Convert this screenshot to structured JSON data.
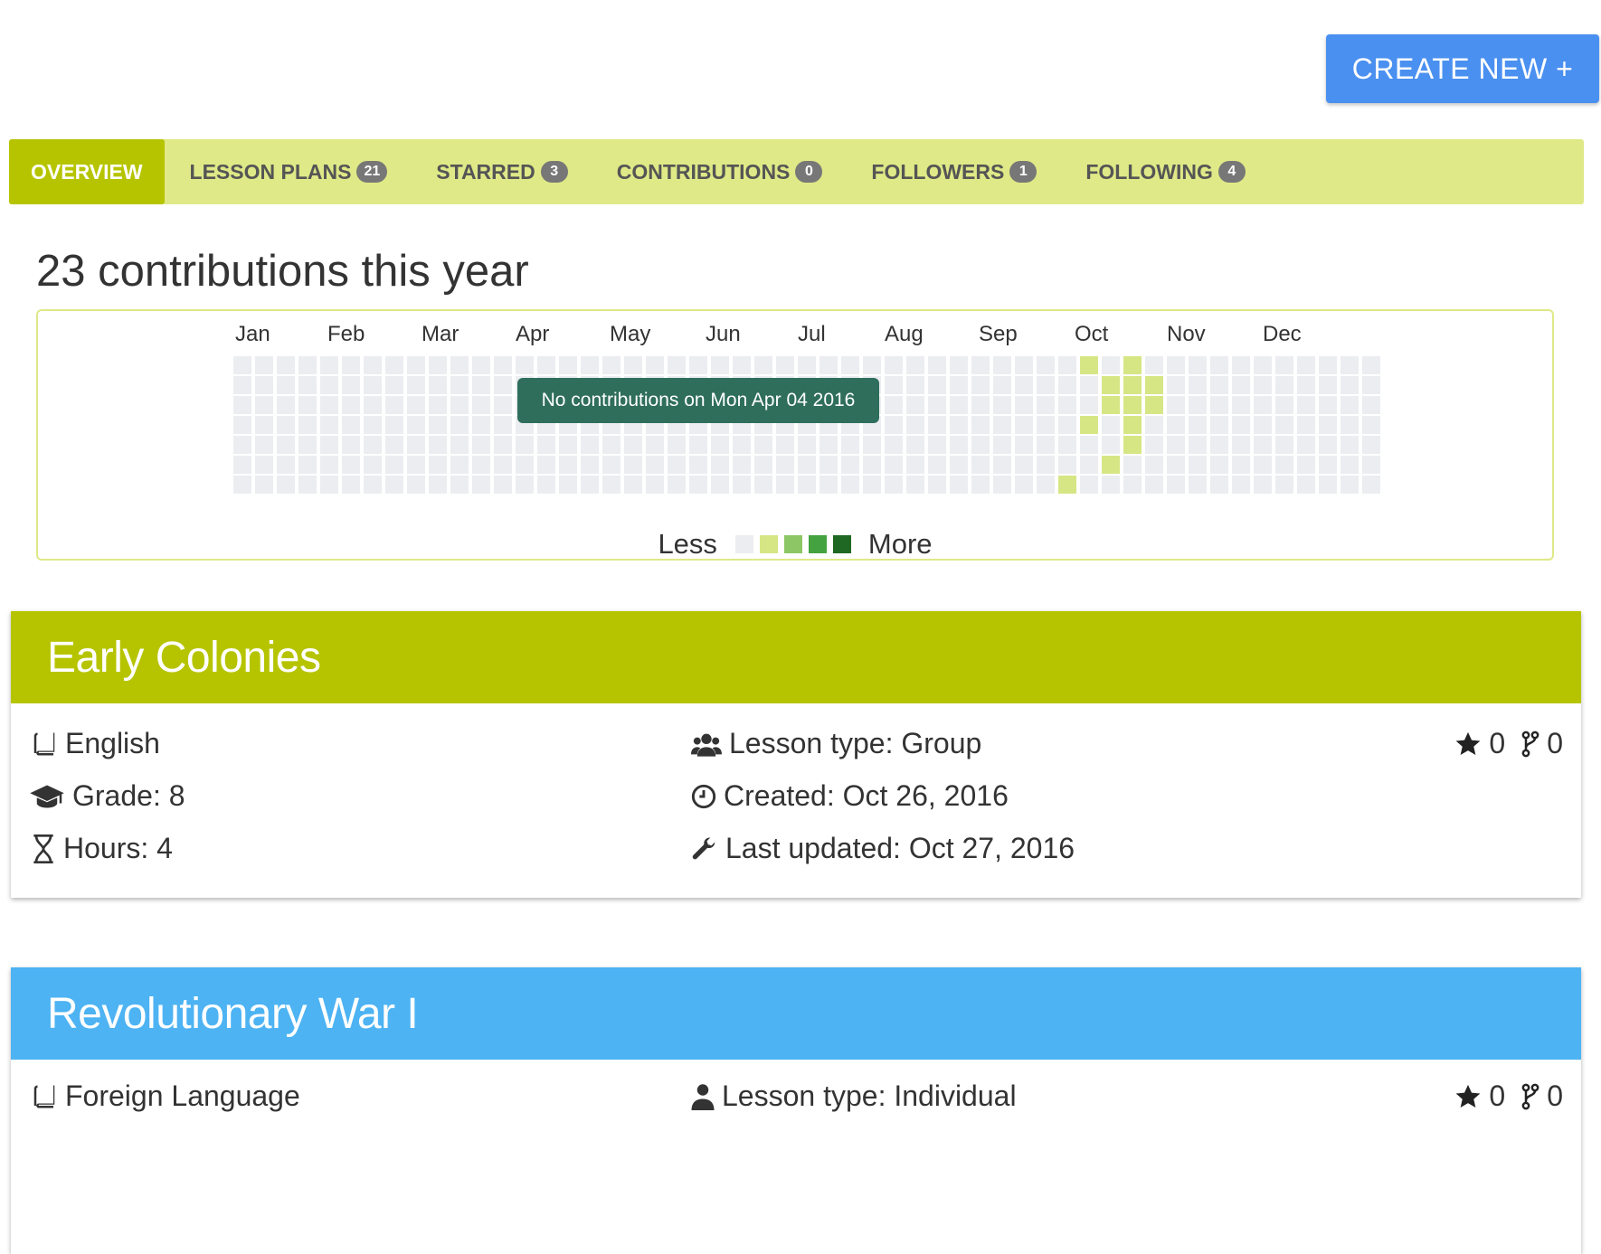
{
  "header": {
    "create_label": "CREATE NEW +"
  },
  "tabs": [
    {
      "label": "OVERVIEW",
      "count": null,
      "active": true
    },
    {
      "label": "LESSON PLANS",
      "count": "21"
    },
    {
      "label": "STARRED",
      "count": "3"
    },
    {
      "label": "CONTRIBUTIONS",
      "count": "0"
    },
    {
      "label": "FOLLOWERS",
      "count": "1"
    },
    {
      "label": "FOLLOWING",
      "count": "4"
    }
  ],
  "contributions": {
    "title": "23 contributions this year",
    "months": [
      "Jan",
      "Feb",
      "Mar",
      "Apr",
      "May",
      "Jun",
      "Jul",
      "Aug",
      "Sep",
      "Oct",
      "Nov",
      "Dec"
    ],
    "tooltip": "No contributions on Mon Apr 04 2016",
    "legend_less": "Less",
    "legend_more": "More",
    "colors": {
      "empty": "#ebedf0",
      "level1": "#d6e685",
      "level2": "#8cc665",
      "level3": "#44a340",
      "level4": "#1e6823"
    },
    "active_days": [
      {
        "week": 38,
        "day": 6,
        "level": 1
      },
      {
        "week": 39,
        "day": 0,
        "level": 1
      },
      {
        "week": 39,
        "day": 3,
        "level": 1
      },
      {
        "week": 40,
        "day": 1,
        "level": 1
      },
      {
        "week": 40,
        "day": 2,
        "level": 1
      },
      {
        "week": 40,
        "day": 5,
        "level": 1
      },
      {
        "week": 41,
        "day": 0,
        "level": 1
      },
      {
        "week": 41,
        "day": 1,
        "level": 1
      },
      {
        "week": 41,
        "day": 2,
        "level": 1
      },
      {
        "week": 41,
        "day": 3,
        "level": 1
      },
      {
        "week": 41,
        "day": 4,
        "level": 1
      },
      {
        "week": 42,
        "day": 1,
        "level": 1
      },
      {
        "week": 42,
        "day": 2,
        "level": 1
      }
    ]
  },
  "lessons": [
    {
      "title": "Early Colonies",
      "header_color": "#b6c400",
      "subject": "English",
      "grade": "Grade: 8",
      "hours": "Hours: 4",
      "lesson_type": "Lesson type: Group",
      "created": "Created: Oct 26, 2016",
      "updated": "Last updated: Oct 27, 2016",
      "stars": "0",
      "forks": "0"
    },
    {
      "title": "Revolutionary War I",
      "header_color": "#4db3f3",
      "subject": "Foreign Language",
      "lesson_type": "Lesson type: Individual",
      "stars": "0",
      "forks": "0"
    }
  ]
}
